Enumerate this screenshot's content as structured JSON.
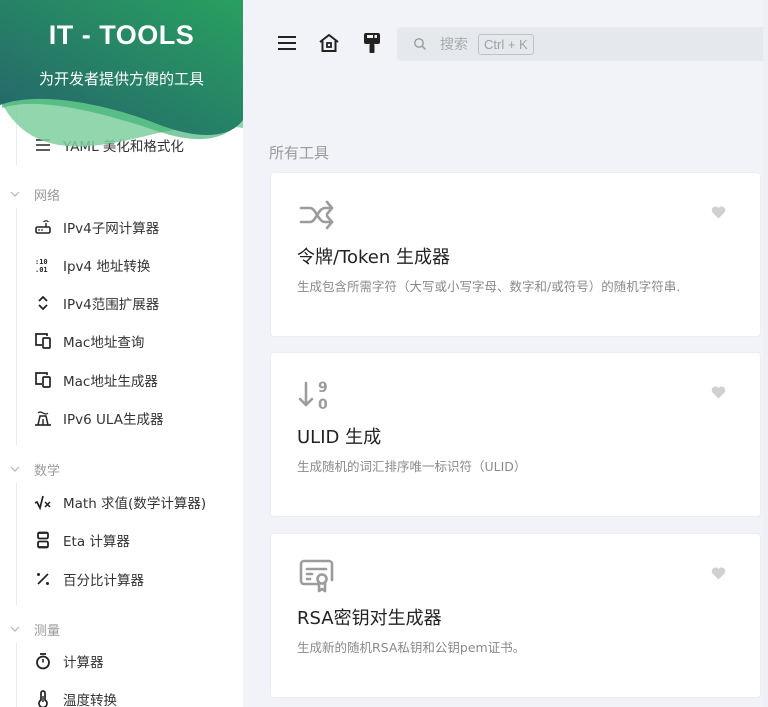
{
  "sidebar": {
    "brand_title": "IT - TOOLS",
    "brand_subtitle": "为开发者提供方便的工具",
    "partial_item": {
      "label": "YAML 美化和格式化",
      "icon": "list-lines-icon"
    },
    "groups": [
      {
        "label": "网络",
        "items": [
          {
            "label": "IPv4子网计算器",
            "icon": "router-icon"
          },
          {
            "label": "Ipv4 地址转换",
            "icon": "binary-icon"
          },
          {
            "label": "IPv4范围扩展器",
            "icon": "unfold-icon"
          },
          {
            "label": "Mac地址查询",
            "icon": "devices-icon"
          },
          {
            "label": "Mac地址生成器",
            "icon": "devices-icon"
          },
          {
            "label": "IPv6 ULA生成器",
            "icon": "building-broadcast-icon"
          }
        ]
      },
      {
        "label": "数学",
        "items": [
          {
            "label": "Math 求值(数学计算器)",
            "icon": "square-root-icon"
          },
          {
            "label": "Eta 计算器",
            "icon": "hourglass-icon"
          },
          {
            "label": "百分比计算器",
            "icon": "percentage-icon"
          }
        ]
      },
      {
        "label": "测量",
        "items": [
          {
            "label": "计算器",
            "icon": "stopwatch-icon"
          },
          {
            "label": "温度转换",
            "icon": "thermometer-icon"
          }
        ]
      }
    ]
  },
  "header": {
    "menu_icon": "hamburger-icon",
    "home_icon": "home-icon",
    "theme_icon": "paint-brush-icon",
    "search": {
      "placeholder": "搜索",
      "shortcut": "Ctrl + K"
    }
  },
  "main": {
    "section_title": "所有工具",
    "cards": [
      {
        "title": "令牌/Token 生成器",
        "description": "生成包含所需字符（大写或小写字母、数字和/或符号）的随机字符串.",
        "icon": "shuffle-arrows-icon",
        "favorite": false
      },
      {
        "title": "ULID 生成",
        "description": "生成随机的词汇排序唯一标识符（ULID）",
        "icon": "sort-numeric-down-icon",
        "favorite": false
      },
      {
        "title": "RSA密钥对生成器",
        "description": "生成新的随机RSA私钥和公钥pem证书。",
        "icon": "certificate-icon",
        "favorite": false
      }
    ]
  },
  "colors": {
    "brand_gradient_start": "#25636c",
    "brand_gradient_end": "#28a060",
    "wave_light": "#7fcf9f",
    "background": "#f1f3f8",
    "card_bg": "#ffffff",
    "favorite_icon": "#d0d0d0"
  }
}
